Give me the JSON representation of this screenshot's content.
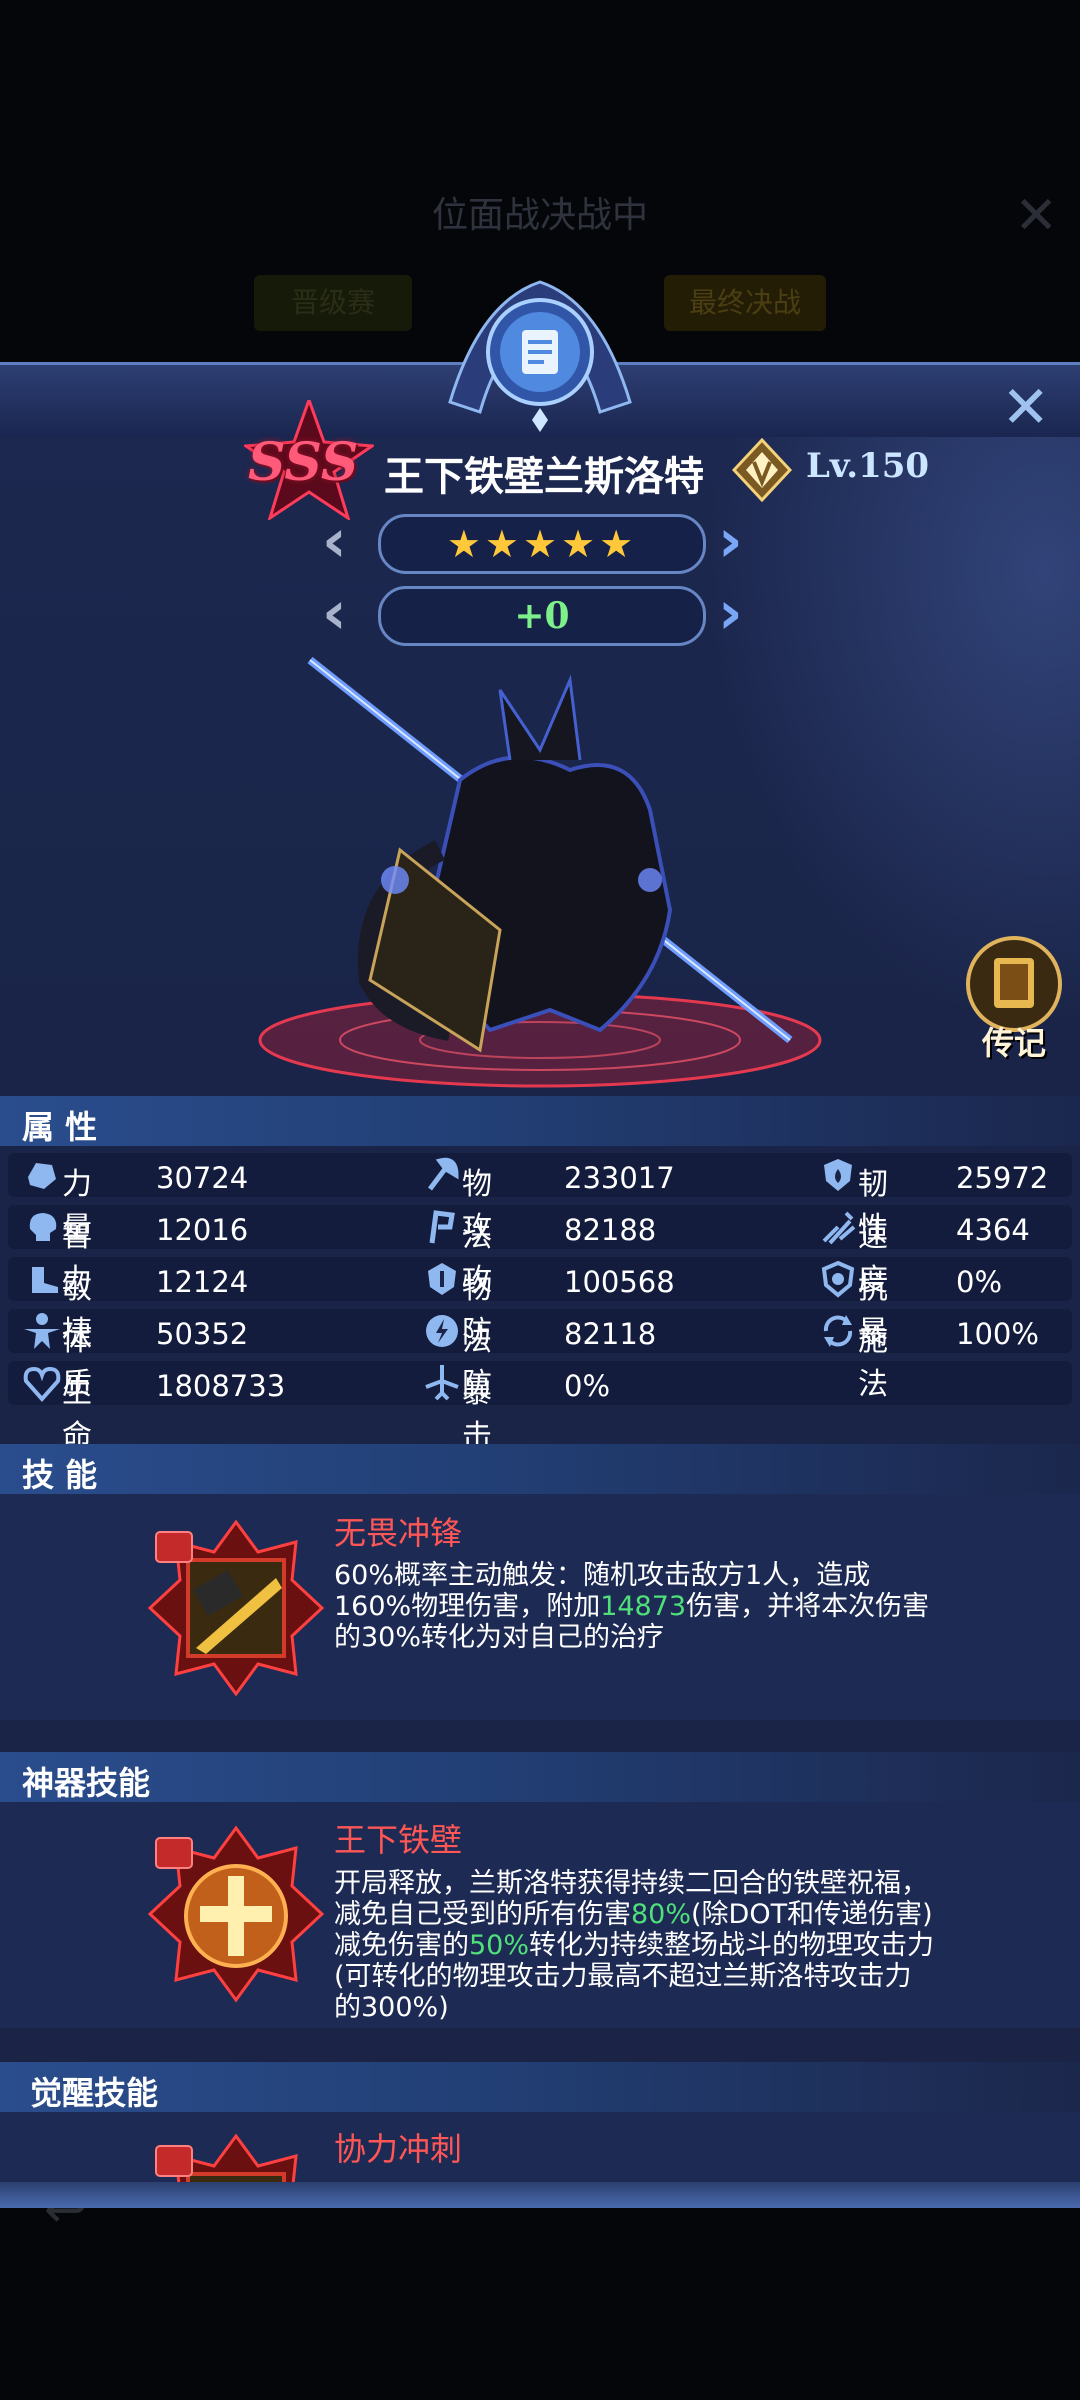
{
  "background": {
    "title": "位面战决战中",
    "tabs": [
      "晋级赛",
      "最终决战"
    ]
  },
  "header": {
    "rank": "SSS",
    "name": "王下铁壁兰斯洛特",
    "level": "Lv.150",
    "stars": "★★★★★",
    "star_count": 5,
    "enhance": "+0"
  },
  "biography_label": "传记",
  "attributes": {
    "title": "属 性",
    "rows": [
      [
        {
          "label": "力量",
          "value": "30724",
          "icon": "fist-icon"
        },
        {
          "label": "物攻",
          "value": "233017",
          "icon": "axe-icon"
        },
        {
          "label": "韧性",
          "value": "25972",
          "icon": "shield-drop-icon"
        }
      ],
      [
        {
          "label": "智力",
          "value": "12016",
          "icon": "brain-head-icon"
        },
        {
          "label": "法攻",
          "value": "82188",
          "icon": "staff-icon"
        },
        {
          "label": "速度",
          "value": "4364",
          "icon": "wind-boot-icon"
        }
      ],
      [
        {
          "label": "敏捷",
          "value": "12124",
          "icon": "dash-boot-icon"
        },
        {
          "label": "物防",
          "value": "100568",
          "icon": "helmet-icon"
        },
        {
          "label": "抗暴",
          "value": "0%",
          "icon": "crest-shield-icon"
        }
      ],
      [
        {
          "label": "体质",
          "value": "50352",
          "icon": "body-icon"
        },
        {
          "label": "法防",
          "value": "82118",
          "icon": "lightning-shield-icon"
        },
        {
          "label": "施法",
          "value": "100%",
          "icon": "cycle-arrows-icon"
        }
      ],
      [
        {
          "label": "生命",
          "value": "1808733",
          "icon": "heart-face-icon"
        },
        {
          "label": "暴击",
          "value": "0%",
          "icon": "sword-wings-icon"
        }
      ]
    ]
  },
  "skills": {
    "title": "技 能",
    "name": "无畏冲锋",
    "desc_parts": [
      "60%概率主动触发：随机攻击敌方1人，造成160%物理伤害，附加",
      "14873",
      "伤害，并将本次伤害的30%转化为对自己的治疗"
    ]
  },
  "artifact_skill": {
    "title": "神器技能",
    "name": "王下铁壁",
    "desc_parts": [
      "开局释放，兰斯洛特获得持续二回合的铁壁祝福，减免自己受到的所有伤害",
      "80%",
      "(除DOT和传递伤害)减免伤害的",
      "50%",
      "转化为持续整场战斗的物理攻击力(可转化的物理攻击力最高不超过兰斯洛特攻击力的300%)"
    ]
  },
  "awaken_skill": {
    "title": "觉醒技能",
    "name": "协力冲刺"
  },
  "colors": {
    "skill_name": "#ff5656",
    "highlight": "#4fe07a",
    "star": "#ffc83a"
  }
}
